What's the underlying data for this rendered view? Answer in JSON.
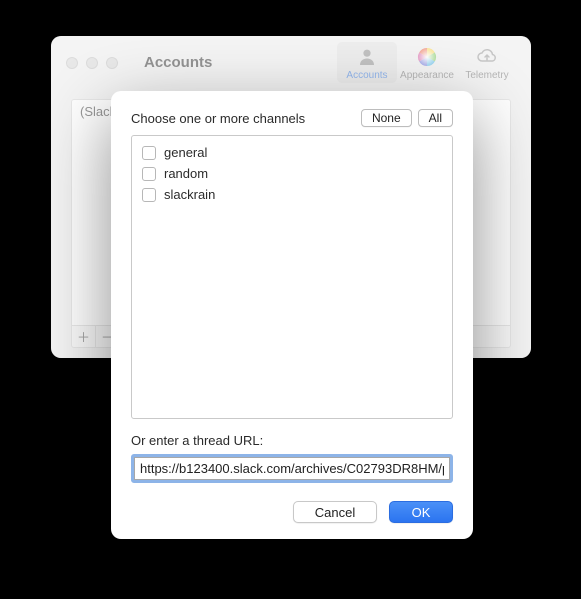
{
  "window": {
    "title": "Accounts",
    "tabs": {
      "accounts": "Accounts",
      "appearance": "Appearance",
      "telemetry": "Telemetry"
    }
  },
  "background_list": {
    "row0": "(Slack…"
  },
  "footer": {
    "plus": "＋",
    "minus": "－"
  },
  "sheet": {
    "channels_label": "Choose one or more channels",
    "none_btn": "None",
    "all_btn": "All",
    "channels": [
      {
        "label": "general"
      },
      {
        "label": "random"
      },
      {
        "label": "slackrain"
      }
    ],
    "url_label": "Or enter a thread URL:",
    "url_value": "https://b123400.slack.com/archives/C02793DR8HM/p",
    "cancel": "Cancel",
    "ok": "OK"
  }
}
